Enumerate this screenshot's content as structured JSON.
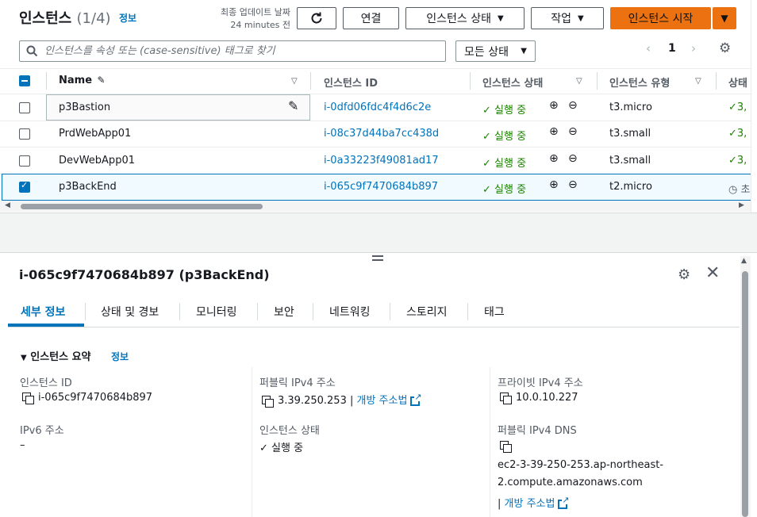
{
  "header": {
    "title": "인스턴스",
    "count": "(1/4)",
    "info": "정보",
    "last_updated_label": "최종 업데이트 날짜",
    "last_updated_value": "24 minutes 전",
    "connect": "연결",
    "instance_state": "인스턴스 상태",
    "actions": "작업",
    "launch": "인스턴스 시작"
  },
  "search": {
    "placeholder": "인스턴스를 속성 또는 (case-sensitive) 태그로 찾기",
    "filter": "모든 상태"
  },
  "pagination": {
    "page": "1"
  },
  "table": {
    "columns": [
      "Name",
      "인스턴스 ID",
      "인스턴스 상태",
      "인스턴스 유형",
      "상태"
    ],
    "rows": [
      {
        "name": "p3Bastion",
        "id": "i-0dfd06fdc4f4d6c2e",
        "state": "실행 중",
        "type": "t3.micro",
        "check": "3,"
      },
      {
        "name": "PrdWebApp01",
        "id": "i-08c37d44ba7cc438d",
        "state": "실행 중",
        "type": "t3.small",
        "check": "3,"
      },
      {
        "name": "DevWebApp01",
        "id": "i-0a33223f49081ad17",
        "state": "실행 중",
        "type": "t3.small",
        "check": "3,"
      },
      {
        "name": "p3BackEnd",
        "id": "i-065c9f7470684b897",
        "state": "실행 중",
        "type": "t2.micro",
        "check": "초"
      }
    ]
  },
  "detail": {
    "title": "i-065c9f7470684b897 (p3BackEnd)",
    "tabs": [
      "세부 정보",
      "상태 및 경보",
      "모니터링",
      "보안",
      "네트워킹",
      "스토리지",
      "태그"
    ],
    "summary_title": "인스턴스 요약",
    "summary_info": "정보",
    "instance_id_label": "인스턴스 ID",
    "instance_id_value": "i-065c9f7470684b897",
    "public_ip_label": "퍼블릭 IPv4 주소",
    "public_ip_value": "3.39.250.253",
    "open_address": "개방 주소법",
    "private_ip_label": "프라이빗 IPv4 주소",
    "private_ip_value": "10.0.10.227",
    "ipv6_label": "IPv6 주소",
    "ipv6_value": "–",
    "state_label": "인스턴스 상태",
    "state_value": "실행 중",
    "public_dns_label": "퍼블릭 IPv4 DNS",
    "public_dns_line1": "ec2-3-39-250-253.ap-northeast-",
    "public_dns_line2": "2.compute.amazonaws.com",
    "open_address2": "개방 주소법"
  },
  "colors": {
    "accent": "#ec7211",
    "link": "#0073bb",
    "success": "#1d8102"
  }
}
